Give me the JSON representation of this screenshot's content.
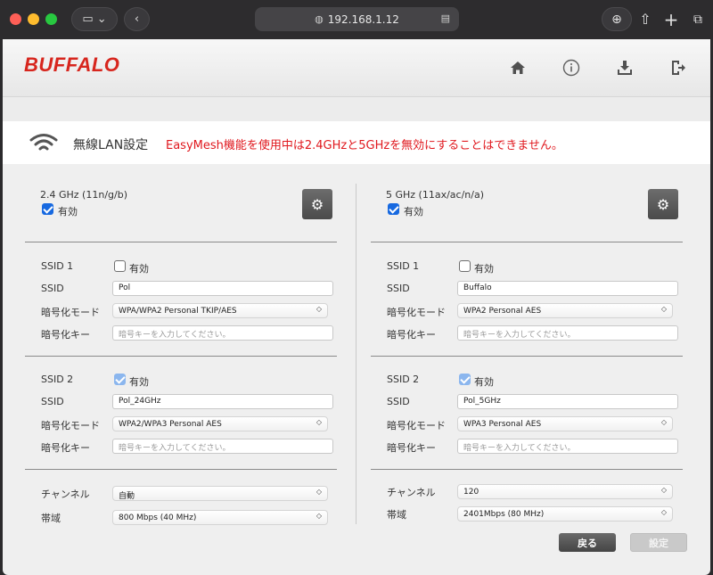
{
  "browser": {
    "url": "192.168.1.12",
    "icons": [
      "sidebar-icon",
      "chevron-down-icon",
      "back-icon",
      "globe-icon",
      "reader-icon",
      "download-icon",
      "share-icon",
      "plus-icon",
      "tabs-icon"
    ]
  },
  "header": {
    "logo": "BUFFALO",
    "logo_color": "#d7261e",
    "icons": [
      "home-icon",
      "info-icon",
      "download-icon",
      "logout-icon"
    ]
  },
  "page": {
    "title": "無線LAN設定",
    "warning": "EasyMesh機能を使用中は2.4GHzと5GHzを無効にすることはできません。",
    "warning_color": "#e0181e"
  },
  "bands": {
    "left": {
      "label": "2.4 GHz (11n/g/b)",
      "enabled_label": "有効",
      "enabled": true,
      "ssid1": {
        "title": "SSID 1",
        "enable_label": "有効",
        "enabled": false,
        "ssid_label": "SSID",
        "ssid_value": "Pol",
        "mode_label": "暗号化モード",
        "mode_value": "WPA/WPA2 Personal TKIP/AES",
        "key_label": "暗号化キー",
        "key_placeholder": "暗号キーを入力してください。"
      },
      "ssid2": {
        "title": "SSID 2",
        "enable_label": "有効",
        "enabled": true,
        "ssid_label": "SSID",
        "ssid_value": "Pol_24GHz",
        "mode_label": "暗号化モード",
        "mode_value": "WPA2/WPA3 Personal AES",
        "key_label": "暗号化キー",
        "key_placeholder": "暗号キーを入力してください。"
      },
      "channel_label": "チャンネル",
      "channel_value": "自動",
      "width_label": "帯域",
      "width_value": "800 Mbps (40 MHz)"
    },
    "right": {
      "label": "5 GHz (11ax/ac/n/a)",
      "enabled_label": "有効",
      "enabled": true,
      "ssid1": {
        "title": "SSID 1",
        "enable_label": "有効",
        "enabled": false,
        "ssid_label": "SSID",
        "ssid_value": "Buffalo",
        "mode_label": "暗号化モード",
        "mode_value": "WPA2 Personal AES",
        "key_label": "暗号化キー",
        "key_placeholder": "暗号キーを入力してください。"
      },
      "ssid2": {
        "title": "SSID 2",
        "enable_label": "有効",
        "enabled": true,
        "ssid_label": "SSID",
        "ssid_value": "Pol_5GHz",
        "mode_label": "暗号化モード",
        "mode_value": "WPA3 Personal AES",
        "key_label": "暗号化キー",
        "key_placeholder": "暗号キーを入力してください。"
      },
      "channel_label": "チャンネル",
      "channel_value": "120",
      "width_label": "帯域",
      "width_value": "2401Mbps (80 MHz)"
    }
  },
  "actions": {
    "back_label": "戻る",
    "apply_label": "設定"
  }
}
